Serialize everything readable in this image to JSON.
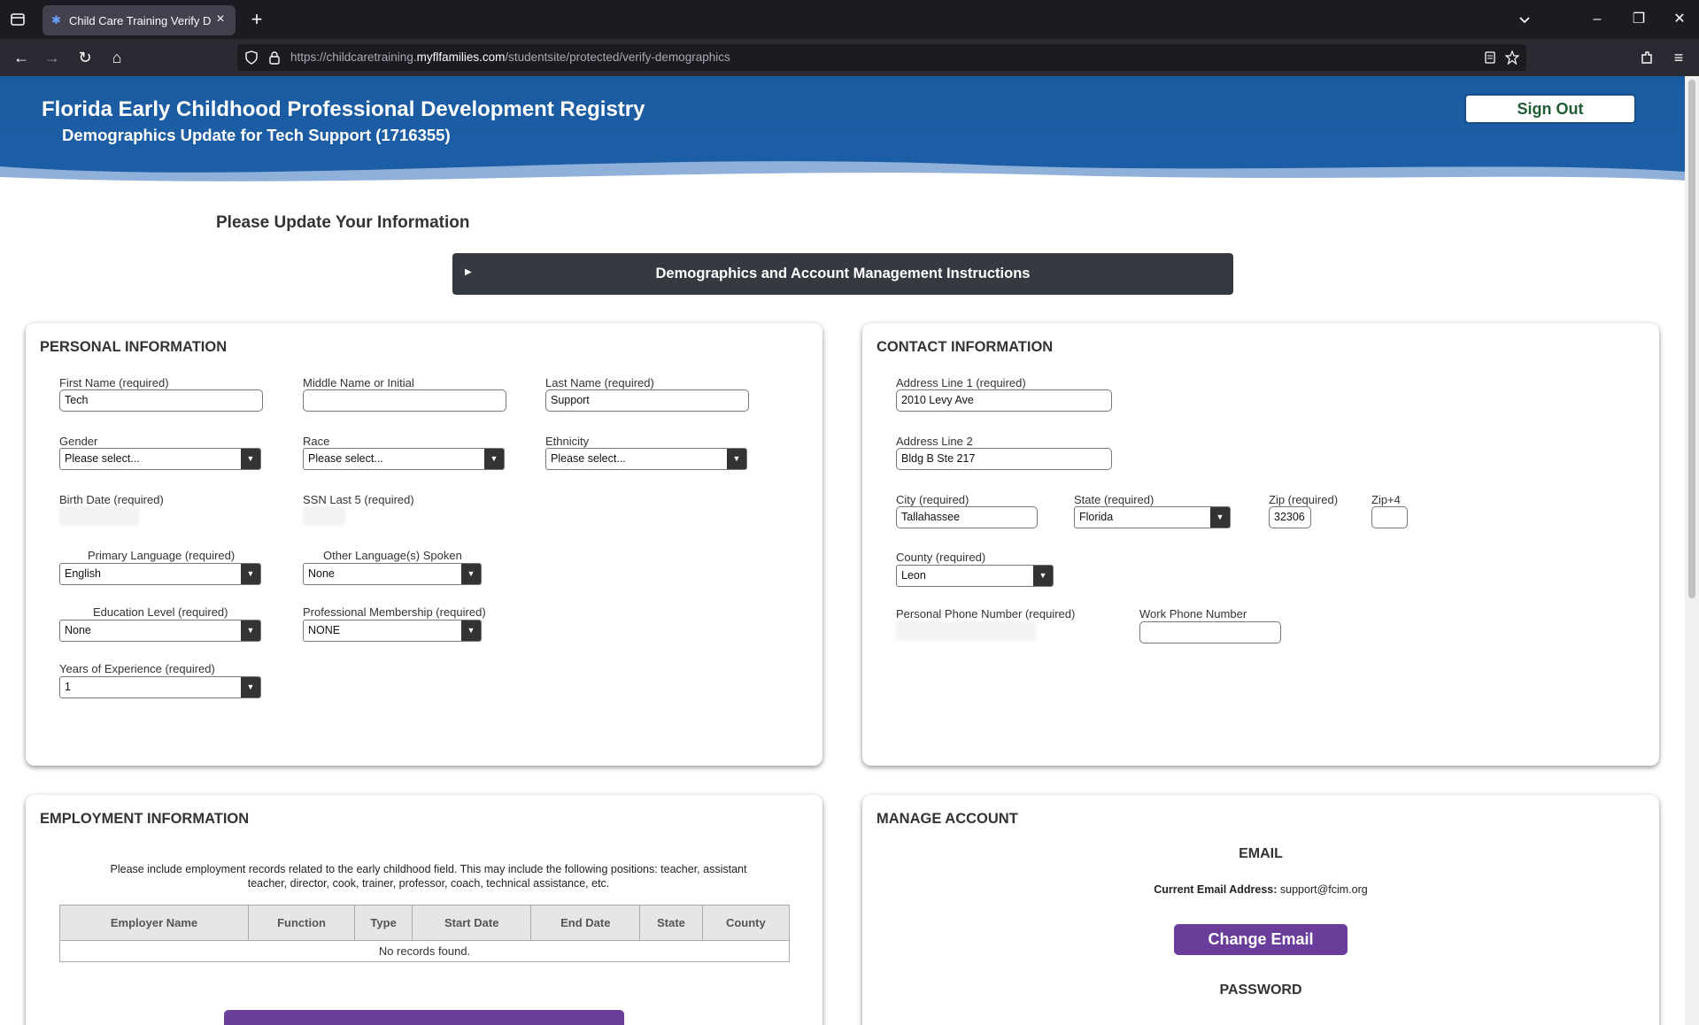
{
  "browser": {
    "tab_title": "Child Care Training Verify Demo",
    "url_prefix": "https://childcaretraining.",
    "url_domain": "myflfamilies.com",
    "url_path": "/studentsite/protected/verify-demographics"
  },
  "header": {
    "title": "Florida Early Childhood Professional Development Registry",
    "subtitle": "Demographics Update for Tech Support (1716355)",
    "sign_out": "Sign Out"
  },
  "page_title": "Please Update Your Information",
  "instructions_label": "Demographics and Account Management Instructions",
  "personal": {
    "title": "PERSONAL INFORMATION",
    "first_name_label": "First Name (required)",
    "first_name": "Tech",
    "middle_name_label": "Middle Name or Initial",
    "middle_name": "",
    "last_name_label": "Last Name (required)",
    "last_name": "Support",
    "gender_label": "Gender",
    "gender": "Please select...",
    "race_label": "Race",
    "race": "Please select...",
    "ethnicity_label": "Ethnicity",
    "ethnicity": "Please select...",
    "birth_date_label": "Birth Date (required)",
    "ssn_label": "SSN Last 5 (required)",
    "primary_language_label": "Primary Language (required)",
    "primary_language": "English",
    "other_language_label": "Other Language(s) Spoken",
    "other_language": "None",
    "education_label": "Education Level (required)",
    "education": "None",
    "membership_label": "Professional Membership (required)",
    "membership": "NONE",
    "experience_label": "Years of Experience (required)",
    "experience": "1"
  },
  "contact": {
    "title": "CONTACT INFORMATION",
    "address1_label": "Address Line 1 (required)",
    "address1": "2010 Levy Ave",
    "address2_label": "Address Line 2",
    "address2": "Bldg B Ste 217",
    "city_label": "City (required)",
    "city": "Tallahassee",
    "state_label": "State (required)",
    "state": "Florida",
    "zip_label": "Zip (required)",
    "zip": "32306",
    "zip4_label": "Zip+4",
    "zip4": "",
    "county_label": "County (required)",
    "county": "Leon",
    "personal_phone_label": "Personal Phone Number (required)",
    "work_phone_label": "Work Phone Number",
    "work_phone": ""
  },
  "employment": {
    "title": "EMPLOYMENT INFORMATION",
    "description": "Please include employment records related to the early childhood field. This may include the following positions: teacher, assistant teacher, director, cook, trainer, professor, coach, technical assistance, etc.",
    "columns": [
      "Employer Name",
      "Function",
      "Type",
      "Start Date",
      "End Date",
      "State",
      "County"
    ],
    "empty_text": "No records found."
  },
  "account": {
    "title": "MANAGE ACCOUNT",
    "email_heading": "EMAIL",
    "current_email_label": "Current Email Address:",
    "current_email": "support@fcim.org",
    "change_email": "Change Email",
    "password_heading": "PASSWORD"
  },
  "colors": {
    "banner_blue": "#1d5fa8",
    "accordion_dark": "#343a40",
    "button_purple": "#6a3d9a"
  }
}
